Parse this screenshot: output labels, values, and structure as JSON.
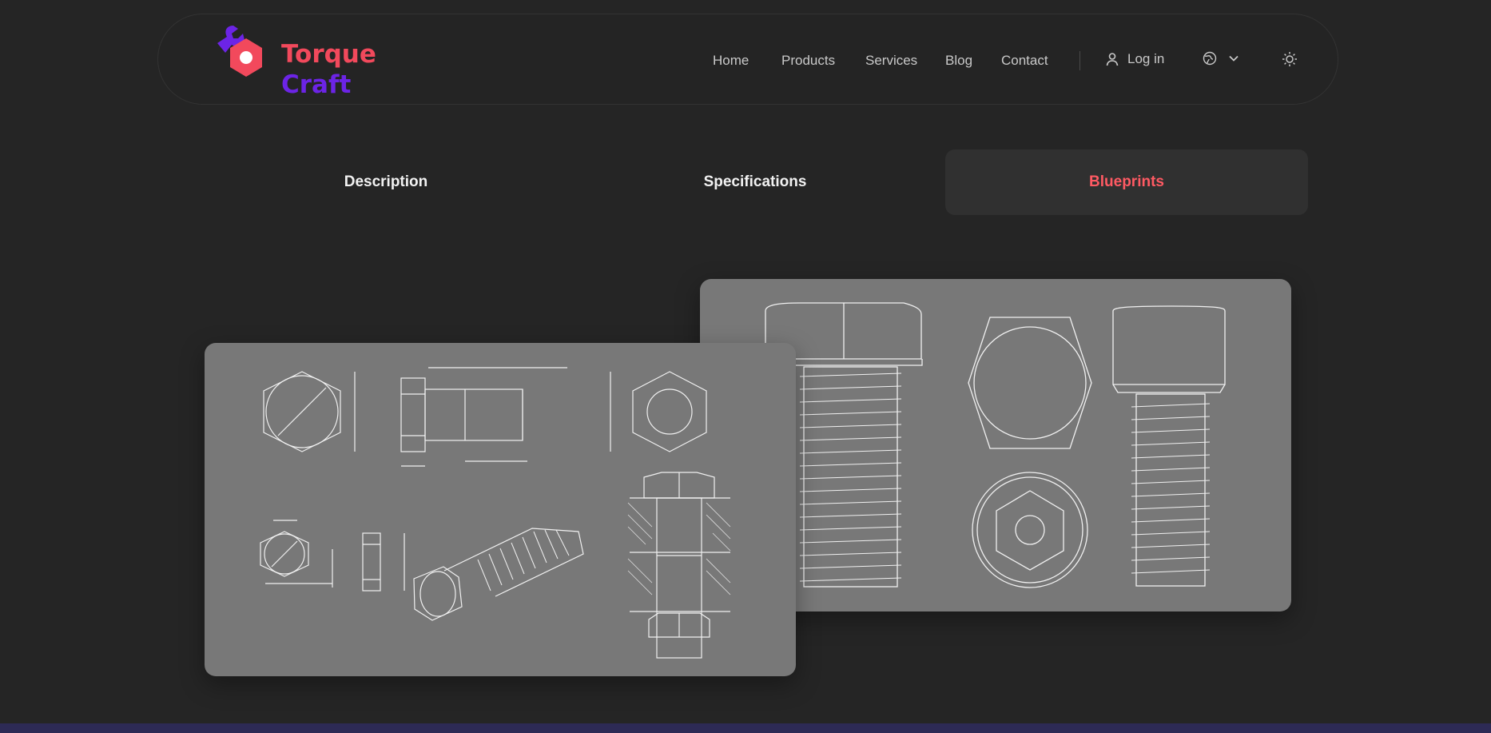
{
  "brand": {
    "name_line1": "Torque",
    "name_line2": "Craft",
    "colors": {
      "primary": "#f2495c",
      "secondary": "#6c24e6"
    },
    "icon": "wrench-hex-nut-logo"
  },
  "nav": {
    "items": [
      "Home",
      "Products",
      "Services",
      "Blog",
      "Contact"
    ],
    "login_label": "Log in",
    "login_icon": "user-icon",
    "language_icon": "globe-icon",
    "language_caret": "chevron-down-icon",
    "theme_icon": "sun-icon"
  },
  "tabs": [
    {
      "label": "Description",
      "active": false
    },
    {
      "label": "Specifications",
      "active": false
    },
    {
      "label": "Blueprints",
      "active": true
    }
  ],
  "colors": {
    "background": "#252525",
    "active_tab_text": "#ff5a63",
    "active_tab_bg": "#303030",
    "card_bg": "#787878",
    "bottom_bar": "#2d2a55"
  },
  "blueprints": {
    "images": [
      "bolt-technical-drawing",
      "bolt-sketch-drawing"
    ]
  }
}
